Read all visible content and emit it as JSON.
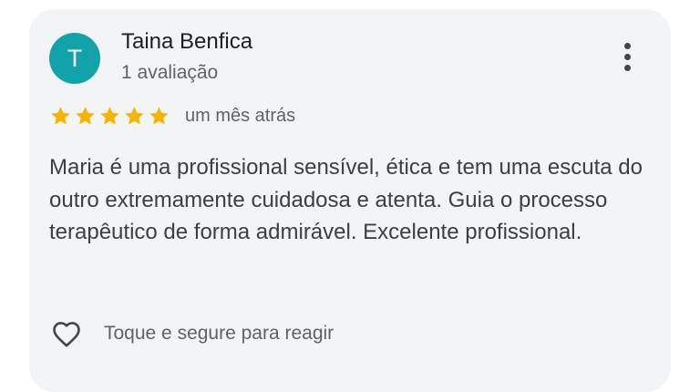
{
  "review": {
    "author": {
      "initial": "T",
      "name": "Taina Benfica",
      "review_count": "1 avaliação",
      "avatar_color": "#12a2aa"
    },
    "rating": 5,
    "star_color": "#f5b400",
    "date": "um mês atrás",
    "text": "Maria é uma profissional sensível, ética e tem uma escuta do outro extremamente cuidadosa e atenta. Guia o processo terapêutico de forma admirável. Excelente profissional.",
    "more_icon": "more-vert-icon",
    "react": {
      "icon": "heart-outline-icon",
      "label": "Toque e segure para reagir"
    }
  }
}
